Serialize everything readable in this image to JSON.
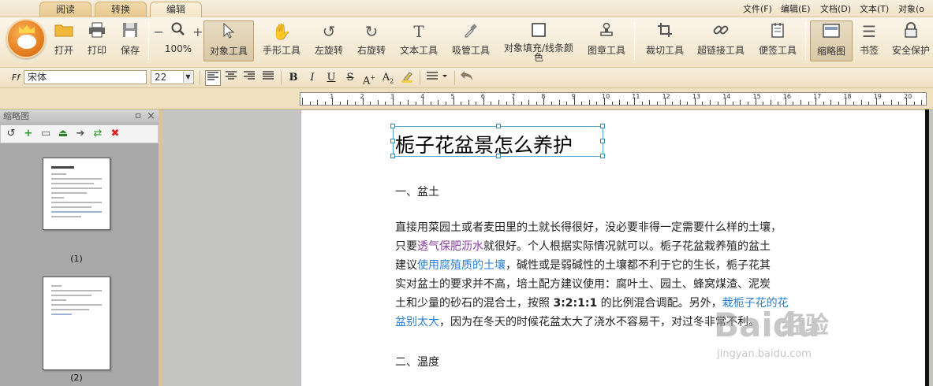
{
  "tabs": [
    {
      "label": "阅读",
      "active": false
    },
    {
      "label": "转换",
      "active": false
    },
    {
      "label": "编辑",
      "active": true
    }
  ],
  "menu": [
    "文件(F)",
    "编辑(E)",
    "文档(D)",
    "文本(T)",
    "对象(o"
  ],
  "toolbar": {
    "open": "打开",
    "print": "打印",
    "save": "保存",
    "zoom_minus": "−",
    "zoom_plus": "+",
    "zoom_level": "100%",
    "object_tool": "对象工具",
    "hand_tool": "手形工具",
    "rotate_left": "左旋转",
    "rotate_right": "右旋转",
    "text_tool": "文本工具",
    "eyedropper": "吸管工具",
    "object_fill_1": "对象填充/线条颜",
    "object_fill_2": "色",
    "stamp_tool": "图章工具",
    "crop_tool": "裁切工具",
    "hyperlink_tool": "超链接工具",
    "note_tool": "便签工具",
    "thumbnail": "缩略图",
    "bookmark": "书签",
    "security": "安全保护"
  },
  "format": {
    "font_name": "宋体",
    "font_size": "22",
    "bold": "B",
    "italic": "I",
    "underline": "U",
    "strike": "S",
    "superscript": "A",
    "subscript": "A"
  },
  "ruler": {
    "labels": [
      "1",
      "2",
      "3",
      "4",
      "5",
      "6",
      "7",
      "8",
      "9",
      "10",
      "11",
      "12",
      "13",
      "14",
      "15",
      "16",
      "17",
      "18",
      "19",
      "20"
    ]
  },
  "thumbnails": {
    "panel_title": "缩略图",
    "pin": "ㅁ",
    "close": "×",
    "pages": [
      {
        "label": "(1)"
      },
      {
        "label": "(2)"
      }
    ]
  },
  "document": {
    "title": "栀子花盆景怎么养护",
    "heading1": "一、盆土",
    "heading2": "二、温度",
    "lines": {
      "l1": "直接用菜园土或者麦田里的土就长得很好，没必要非得一定需要什么样的土壤，",
      "l2_a": "只要",
      "l2_link": "透气保肥沥水",
      "l2_b": "就很好。个人根据实际情况就可以。栀子花盆栽养殖的盆土",
      "l3_a": "建议",
      "l3_link": "使用腐殖质的土壤",
      "l3_b": "，碱性或是弱碱性的土壤都不利于它的生长，栀子花其",
      "l4": "实对盆土的要求并不高，培土配方建议使用：腐叶土、园土、蜂窝煤渣、泥炭",
      "l5_a": "土和少量的砂石的混合土，按照 ",
      "l5_bold": "3:2:1:1",
      "l5_b": " 的比例混合调配。另外，",
      "l5_link": "栽栀子花的花",
      "l6_link": "盆别太大",
      "l6_b": "，因为在冬天的时候花盆太大了浇水不容易干，对过冬非常不利。"
    }
  },
  "watermark": {
    "brand": "Baidu",
    "text": "经验",
    "url": "jingyan.baidu.com"
  },
  "colors": {
    "accent": "#e1781b",
    "link_purple": "#8a3fa0",
    "link_blue": "#2a7fd4",
    "selection": "#55a7c8"
  }
}
